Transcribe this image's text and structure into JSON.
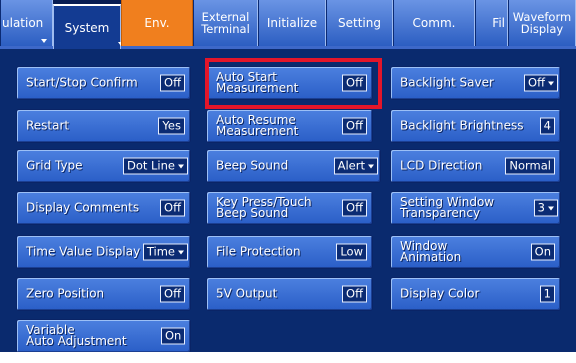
{
  "tabs": [
    {
      "label": "ulation",
      "active": false
    },
    {
      "label": "System",
      "active": true
    },
    {
      "label": "Env.",
      "active": false
    },
    {
      "label": "External\nTerminal",
      "active": false
    },
    {
      "label": "Initialize",
      "active": false
    },
    {
      "label": "Setting",
      "active": false
    },
    {
      "label": "Comm.",
      "active": false
    },
    {
      "label": "Fil",
      "active": false
    },
    {
      "label": "Waveform\nDisplay",
      "active": false
    }
  ],
  "col1": [
    {
      "label": "Start/Stop Confirm",
      "value": "Off"
    },
    {
      "label": "Restart",
      "value": "Yes"
    },
    {
      "label": "Grid Type",
      "value": "Dot Line"
    },
    {
      "label": "Display Comments",
      "value": "Off"
    },
    {
      "label": "Time Value Display",
      "value": "Time"
    },
    {
      "label": "Zero Position",
      "value": "Off"
    },
    {
      "label": "Variable\nAuto Adjustment",
      "value": "On"
    }
  ],
  "col2": [
    {
      "label": "Auto Start\nMeasurement",
      "value": "Off"
    },
    {
      "label": "Auto Resume\nMeasurement",
      "value": "Off"
    },
    {
      "label": "Beep Sound",
      "value": "Alert"
    },
    {
      "label": "Key Press/Touch\nBeep Sound",
      "value": "Off"
    },
    {
      "label": "File Protection",
      "value": "Low"
    },
    {
      "label": "5V Output",
      "value": "Off"
    }
  ],
  "col3": [
    {
      "label": "Backlight Saver",
      "value": "Off"
    },
    {
      "label": "Backlight Brightness",
      "value": "4"
    },
    {
      "label": "LCD Direction",
      "value": "Normal"
    },
    {
      "label": "Setting Window\nTransparency",
      "value": "3"
    },
    {
      "label": "Window\nAnimation",
      "value": "On"
    },
    {
      "label": "Display Color",
      "value": "1"
    }
  ],
  "colors": {
    "background": "#0a2a6e",
    "button": "#3a6fd6",
    "env_tab": "#f07f1e",
    "highlight": "#e3162a"
  }
}
